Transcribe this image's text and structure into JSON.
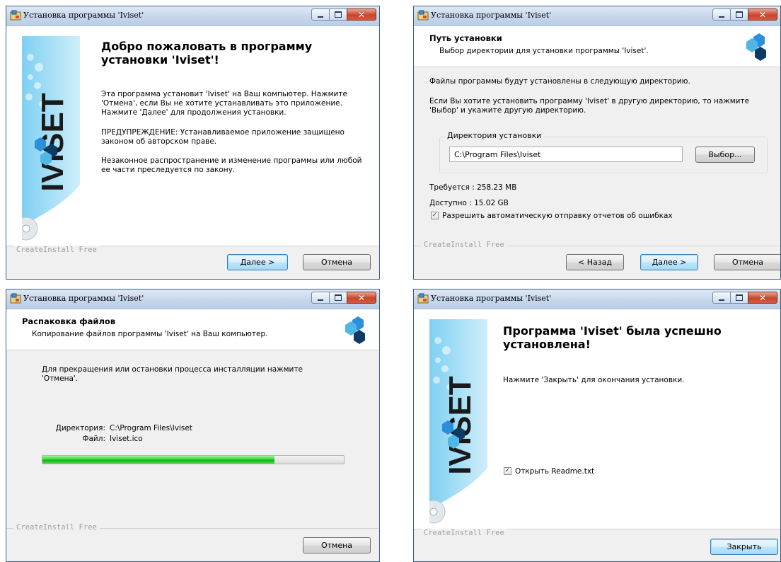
{
  "window_title": "Установка программы 'Iviset'",
  "brand_text": "IVISET",
  "footer_brand": "CreateInstall Free",
  "welcome": {
    "heading": "Добро пожаловать в программу установки 'Iviset'!",
    "para1": "Эта программа установит 'Iviset' на Ваш компьютер. Нажмите 'Отмена', если Вы не хотите устанавливать это приложение. Нажмите 'Далее' для продолжения установки.",
    "para2": "ПРЕДУПРЕЖДЕНИЕ: Устанавливаемое приложение защищено законом об авторском праве.",
    "para3": "Незаконное распространение и изменение программы или любой ее части преследуется по закону.",
    "next_label": "Далее >",
    "cancel_label": "Отмена"
  },
  "path": {
    "header_title": "Путь установки",
    "header_sub": "Выбор директории для установки программы 'Iviset'.",
    "para1": "Файлы программы будут установлены в следующую директорию.",
    "para2": "Если Вы хотите установить программу 'Iviset' в другую директорию, то нажмите 'Выбор' и укажите другую директорию.",
    "group_label": "Директория установки",
    "dir_value": "C:\\Program Files\\Iviset",
    "browse_label": "Выбор...",
    "required": "Требуется : 258.23 MB",
    "available": "Доступно : 15.02 GB",
    "checkbox_label": "Разрешить автоматическую отправку отчетов об ошибках",
    "checkbox_checked": true,
    "back_label": "< Назад",
    "next_label": "Далее >",
    "cancel_label": "Отмена"
  },
  "extract": {
    "header_title": "Распаковка файлов",
    "header_sub": "Копирование файлов программы 'Iviset' на Ваш компьютер.",
    "para1": "Для прекращения или остановки процесса инсталляции нажмите 'Отмена'.",
    "dir_label": "Директория:",
    "dir_value": "C:\\Program Files\\Iviset",
    "file_label": "Файл:",
    "file_value": "Iviset.ico",
    "progress_fraction": 0.77,
    "cancel_label": "Отмена"
  },
  "finish": {
    "heading": "Программа 'Iviset' была успешно установлена!",
    "para1": "Нажмите 'Закрыть' для окончания установки.",
    "checkbox_label": "Открыть Readme.txt",
    "checkbox_checked": true,
    "close_label": "Закрыть"
  },
  "colors": {
    "progress": "#1ec21d",
    "default_button": "#3c7fb1",
    "banner_blue": "#4fb6e6",
    "logo_dark": "#0e3a66"
  }
}
